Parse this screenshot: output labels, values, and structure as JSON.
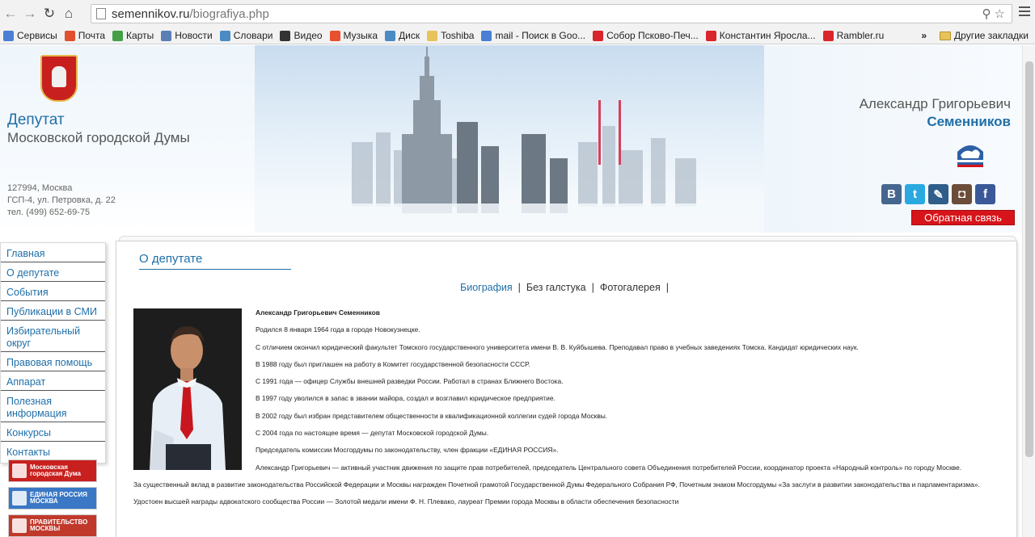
{
  "browser": {
    "url_host": "semennikov.ru",
    "url_path": "/biografiya.php",
    "bookmarks": [
      {
        "label": "Сервисы",
        "color": "#4a7fd4"
      },
      {
        "label": "Почта",
        "color": "#e0502f"
      },
      {
        "label": "Карты",
        "color": "#43a047"
      },
      {
        "label": "Новости",
        "color": "#5b7fb5"
      },
      {
        "label": "Словари",
        "color": "#4a8bc4"
      },
      {
        "label": "Видео",
        "color": "#333333"
      },
      {
        "label": "Музыка",
        "color": "#e8502f"
      },
      {
        "label": "Диск",
        "color": "#4a8bc4"
      },
      {
        "label": "Toshiba",
        "color": "#e7c35a"
      },
      {
        "label": "mail - Поиск в Goo...",
        "color": "#4a7fd4"
      },
      {
        "label": "Собор Псково-Печ...",
        "color": "#d9262c"
      },
      {
        "label": "Константин Яросла...",
        "color": "#d9262c"
      },
      {
        "label": "Rambler.ru",
        "color": "#d9262c"
      }
    ],
    "more_chevron": "»",
    "other_bookmarks": "Другие закладки"
  },
  "header": {
    "title_line1": "Депутат",
    "title_line2": "Московской городской Думы",
    "address": [
      "127994, Москва",
      "ГСП-4, ул. Петровка, д. 22",
      "тел. (499) 652-69-75"
    ],
    "first_names": "Александр Григорьевич",
    "last_name": "Семенников",
    "party_logo_text": "ЕДИНАЯ РОССИЯ",
    "socials": [
      {
        "name": "vk",
        "glyph": "B",
        "color": "#45668e"
      },
      {
        "name": "twitter",
        "glyph": "t",
        "color": "#2aa9e0"
      },
      {
        "name": "livejournal",
        "glyph": "✎",
        "color": "#2f5e8a"
      },
      {
        "name": "instagram",
        "glyph": "◘",
        "color": "#6b4d3a"
      },
      {
        "name": "facebook",
        "glyph": "f",
        "color": "#3b5998"
      }
    ],
    "feedback_label": "Обратная связь"
  },
  "sidebar": {
    "items": [
      "Главная",
      "О депутате",
      "События",
      "Публикации в СМИ",
      "Избирательный округ",
      "Правовая помощь",
      "Аппарат",
      "Полезная информация",
      "Конкурсы",
      "Контакты"
    ],
    "banners": [
      {
        "label": "Московская городская Дума",
        "color": "#c8201e"
      },
      {
        "label": "ЕДИНАЯ РОССИЯ МОСКВА",
        "color": "#3a78c5"
      },
      {
        "label": "ПРАВИТЕЛЬСТВО МОСКВЫ",
        "color": "#c0392b"
      }
    ]
  },
  "content": {
    "section_title": "О депутате",
    "subnav": [
      "Биография",
      "Без галстука",
      "Фотогалерея"
    ],
    "subnav_sep": "|",
    "bio_name": "Александр Григорьевич Семенников",
    "paragraphs": [
      "Родился 8 января 1964 года в городе Новокузнецке.",
      "С отличием окончил юридический факультет Томского государственного университета имени В. В. Куйбышева. Преподавал право в учебных заведениях Томска. Кандидат юридических наук.",
      "В 1988 году был приглашен на работу в Комитет государственной безопасности СССР.",
      "С 1991 года — офицер Службы внешней разведки России. Работал в странах Ближнего Востока.",
      "В 1997 году уволился в запас в звании майора, создал и возглавил юридическое предприятие.",
      "В 2002 году был избран представителем общественности в квалификационной коллегии судей города Москвы.",
      "С 2004 года по настоящее время — депутат Московской городской Думы.",
      "Председатель комиссии Мосгордумы по законодательству, член фракции «ЕДИНАЯ РОССИЯ».",
      "Александр Григорьевич — активный участник движения по защите прав потребителей, председатель Центрального совета Объединения потребителей России, координатор проекта «Народный контроль» по городу Москве.",
      "За существенный вклад в развитие законодательства Российской Федерации и Москвы награжден Почетной грамотой Государственной Думы Федерального Собрания РФ, Почетным знаком Мосгордумы «За заслуги в развитии законодательства и парламентаризма».",
      "Удостоен высшей награды адвокатского сообщества России — Золотой медали имени Ф. Н. Плевако, лауреат Премии города Москвы в области обеспечения безопасности"
    ]
  }
}
